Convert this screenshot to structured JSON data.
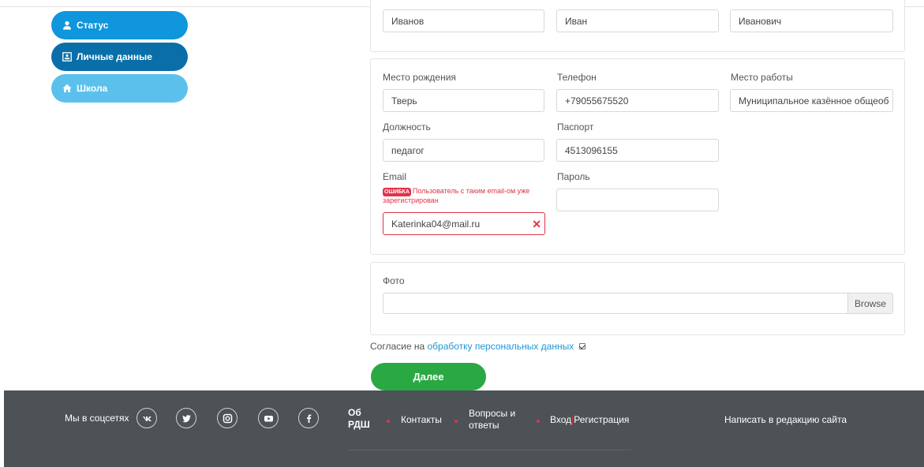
{
  "sidebar": {
    "items": [
      {
        "label": "Статус",
        "icon": "user-icon"
      },
      {
        "label": "Личные данные",
        "icon": "id-card-icon"
      },
      {
        "label": "Школа",
        "icon": "home-icon"
      }
    ]
  },
  "name_row": {
    "last_name": "Иванов",
    "first_name": "Иван",
    "middle_name": "Иванович"
  },
  "fields": {
    "birthplace": {
      "label": "Место рождения",
      "value": "Тверь"
    },
    "phone": {
      "label": "Телефон",
      "value": "+79055675520"
    },
    "workplace": {
      "label": "Место работы",
      "value": "Муниципальное казённое общеоб"
    },
    "position": {
      "label": "Должность",
      "value": "педагог"
    },
    "passport": {
      "label": "Паспорт",
      "value": "4513096155"
    },
    "email": {
      "label": "Email",
      "value": "Katerinka04@mail.ru"
    },
    "password": {
      "label": "Пароль",
      "value": ""
    }
  },
  "email_error": {
    "badge": "ОШИБКА",
    "message": "Пользователь с таким email-ом уже зарегистрирован"
  },
  "photo": {
    "label": "Фото",
    "value": "",
    "browse_label": "Browse"
  },
  "consent": {
    "prefix": "Согласие на",
    "link": "обработку персональных данных",
    "checked": true
  },
  "next_label": "Далее",
  "footer": {
    "social_label": "Мы в соцсетях",
    "social_icons": [
      "vk-icon",
      "twitter-icon",
      "instagram-icon",
      "youtube-icon",
      "facebook-icon"
    ],
    "about_line1": "Об",
    "about_line2": "РДШ",
    "contacts": "Контакты",
    "faq_line1": "Вопросы и",
    "faq_line2": "ответы",
    "login": "Вход",
    "register": "Регистрация",
    "write_editors": "Написать в редакцию сайта"
  },
  "colors": {
    "primary_blue": "#0f96dc",
    "dark_blue": "#0a6fa8",
    "light_blue": "#5cc0ec",
    "green": "#2aa844",
    "error_red": "#e0344a",
    "footer_bg": "#4c5255"
  }
}
